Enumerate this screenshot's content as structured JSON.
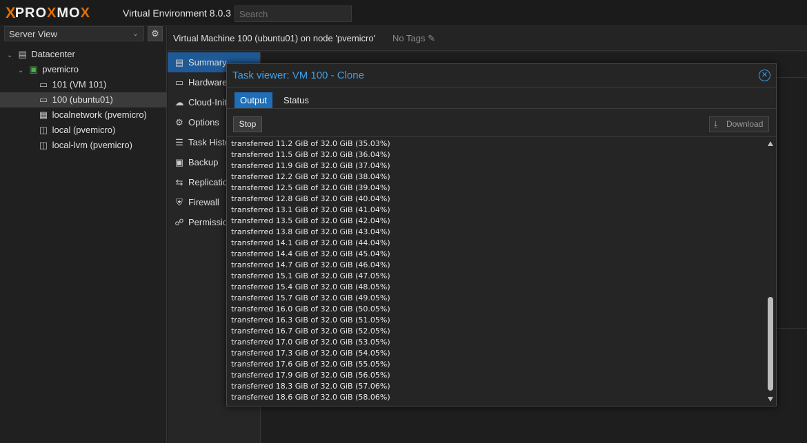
{
  "header": {
    "logo_x": "X",
    "logo_text_a": "PRO",
    "logo_text_b": "X",
    "logo_text_c": "MO",
    "logo_text_d": "X",
    "product": "Virtual Environment 8.0.3",
    "search_placeholder": "Search"
  },
  "tree": {
    "view_label": "Server View",
    "items": [
      {
        "label": "Datacenter",
        "icon": "server-rack-icon"
      },
      {
        "label": "pvemicro",
        "icon": "node-icon"
      },
      {
        "label": "101 (VM 101)",
        "icon": "vm-icon"
      },
      {
        "label": "100 (ubuntu01)",
        "icon": "vm-icon"
      },
      {
        "label": "localnetwork (pvemicro)",
        "icon": "network-grid-icon"
      },
      {
        "label": "local (pvemicro)",
        "icon": "storage-icon"
      },
      {
        "label": "local-lvm (pvemicro)",
        "icon": "storage-icon"
      }
    ]
  },
  "content": {
    "title": "Virtual Machine 100 (ubuntu01) on node 'pvemicro'",
    "tags": "No Tags",
    "nav": [
      {
        "label": "Summary",
        "icon": "book-icon"
      },
      {
        "label": "Hardware",
        "icon": "monitor-icon"
      },
      {
        "label": "Cloud-Init",
        "icon": "cloud-icon"
      },
      {
        "label": "Options",
        "icon": "gear-icon"
      },
      {
        "label": "Task History",
        "icon": "list-icon"
      },
      {
        "label": "Backup",
        "icon": "save-icon"
      },
      {
        "label": "Replication",
        "icon": "retweet-icon"
      },
      {
        "label": "Firewall",
        "icon": "shield-icon"
      },
      {
        "label": "Permissions",
        "icon": "unlock-icon"
      }
    ]
  },
  "modal": {
    "title": "Task viewer: VM 100 - Clone",
    "tabs": {
      "output": "Output",
      "status": "Status"
    },
    "stop_label": "Stop",
    "download_label": "Download",
    "log": [
      "transferred 11.2 GiB of 32.0 GiB (35.03%)",
      "transferred 11.5 GiB of 32.0 GiB (36.04%)",
      "transferred 11.9 GiB of 32.0 GiB (37.04%)",
      "transferred 12.2 GiB of 32.0 GiB (38.04%)",
      "transferred 12.5 GiB of 32.0 GiB (39.04%)",
      "transferred 12.8 GiB of 32.0 GiB (40.04%)",
      "transferred 13.1 GiB of 32.0 GiB (41.04%)",
      "transferred 13.5 GiB of 32.0 GiB (42.04%)",
      "transferred 13.8 GiB of 32.0 GiB (43.04%)",
      "transferred 14.1 GiB of 32.0 GiB (44.04%)",
      "transferred 14.4 GiB of 32.0 GiB (45.04%)",
      "transferred 14.7 GiB of 32.0 GiB (46.04%)",
      "transferred 15.1 GiB of 32.0 GiB (47.05%)",
      "transferred 15.4 GiB of 32.0 GiB (48.05%)",
      "transferred 15.7 GiB of 32.0 GiB (49.05%)",
      "transferred 16.0 GiB of 32.0 GiB (50.05%)",
      "transferred 16.3 GiB of 32.0 GiB (51.05%)",
      "transferred 16.7 GiB of 32.0 GiB (52.05%)",
      "transferred 17.0 GiB of 32.0 GiB (53.05%)",
      "transferred 17.3 GiB of 32.0 GiB (54.05%)",
      "transferred 17.6 GiB of 32.0 GiB (55.05%)",
      "transferred 17.9 GiB of 32.0 GiB (56.05%)",
      "transferred 18.3 GiB of 32.0 GiB (57.06%)",
      "transferred 18.6 GiB of 32.0 GiB (58.06%)"
    ]
  },
  "colors": {
    "accent": "#3f9fe6",
    "brand": "#e57000",
    "selected_nav": "#1f5a96"
  }
}
